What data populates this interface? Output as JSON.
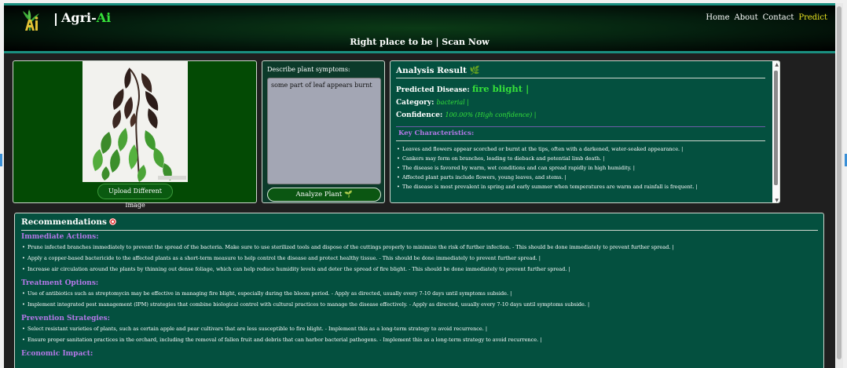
{
  "header": {
    "brand_prefix": "Agri-",
    "brand_suffix": "Ai",
    "tagline": "Right place to be | Scan Now",
    "nav": [
      "Home",
      "About",
      "Contact",
      "Predict"
    ],
    "active_nav": "Predict"
  },
  "image_panel": {
    "upload_label": "Upload Different Image"
  },
  "symptoms": {
    "label": "Describe plant symptoms:",
    "value": "some part of leaf appears burnt",
    "analyze_label": "Analyze Plant 🌱"
  },
  "analysis": {
    "title": "Analysis Result 🌿",
    "predicted_label": "Predicted Disease:",
    "predicted_value": "fire blight |",
    "category_label": "Category:",
    "category_value": "bacterial |",
    "confidence_label": "Confidence:",
    "confidence_value": "100.00% (High confidence) |",
    "key_heading": "Key Characteristics:",
    "characteristics": [
      "Leaves and flowers appear scorched or burnt at the tips, often with a darkened, water-soaked appearance. |",
      "Cankers may form on branches, leading to dieback and potential limb death. |",
      "The disease is favored by warm, wet conditions and can spread rapidly in high humidity. |",
      "Affected plant parts include flowers, young leaves, and stems. |",
      "The disease is most prevalent in spring and early summer when temperatures are warm and rainfall is frequent. |"
    ]
  },
  "recommendations": {
    "title": "Recommendations",
    "sections": [
      {
        "heading": "Immediate Actions:",
        "items": [
          "Prune infected branches immediately to prevent the spread of the bacteria. Make sure to use sterilized tools and dispose of the cuttings properly to minimize the risk of further infection. - This should be done immediately to prevent further spread. |",
          "Apply a copper-based bactericide to the affected plants as a short-term measure to help control the disease and protect healthy tissue. - This should be done immediately to prevent further spread. |",
          "Increase air circulation around the plants by thinning out dense foliage, which can help reduce humidity levels and deter the spread of fire blight. - This should be done immediately to prevent further spread. |"
        ]
      },
      {
        "heading": "Treatment Options:",
        "items": [
          "Use of antibiotics such as streptomycin may be effective in managing fire blight, especially during the bloom period. - Apply as directed, usually every 7-10 days until symptoms subside. |",
          "Implement integrated pest management (IPM) strategies that combine biological control with cultural practices to manage the disease effectively. - Apply as directed, usually every 7-10 days until symptoms subside. |"
        ]
      },
      {
        "heading": "Prevention Strategies:",
        "items": [
          "Select resistant varieties of plants, such as certain apple and pear cultivars that are less susceptible to fire blight. - Implement this as a long-term strategy to avoid recurrence. |",
          "Ensure proper sanitation practices in the orchard, including the removal of fallen fruit and debris that can harbor bacterial pathogens. - Implement this as a long-term strategy to avoid recurrence. |"
        ]
      },
      {
        "heading": "Economic Impact:",
        "items": []
      }
    ]
  }
}
